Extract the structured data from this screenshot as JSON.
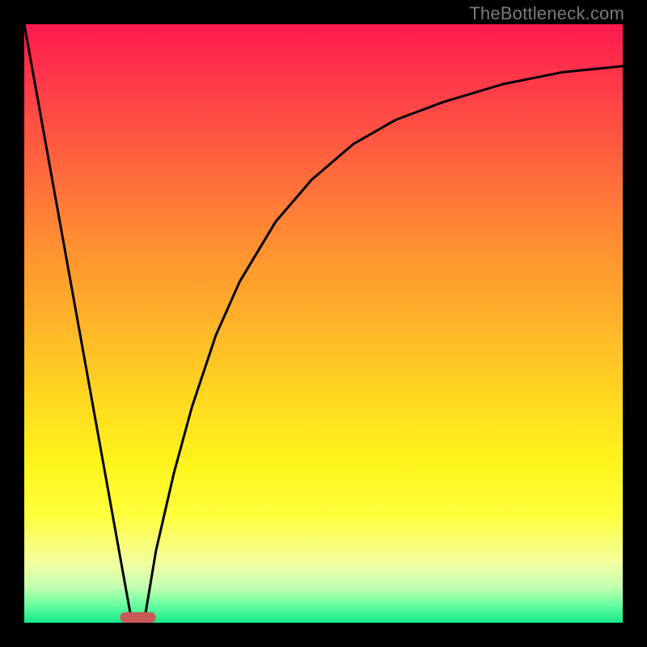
{
  "watermark": "TheBottleneck.com",
  "chart_data": {
    "type": "line",
    "title": "",
    "xlabel": "",
    "ylabel": "",
    "xlim": [
      0,
      100
    ],
    "ylim": [
      0,
      100
    ],
    "grid": false,
    "legend": false,
    "series": [
      {
        "name": "left-branch",
        "x": [
          0,
          18
        ],
        "y": [
          100,
          0
        ]
      },
      {
        "name": "right-branch",
        "x": [
          20,
          22,
          25,
          28,
          32,
          36,
          42,
          48,
          55,
          62,
          70,
          80,
          90,
          100
        ],
        "y": [
          0,
          12,
          25,
          36,
          48,
          57,
          67,
          74,
          80,
          84,
          87,
          90,
          92,
          93
        ]
      }
    ],
    "marker": {
      "name": "optimum-marker",
      "x_start": 16,
      "x_end": 22,
      "color": "#c95a5a"
    },
    "colors": {
      "curve": "#000000",
      "gradient_top": "#ff1a4f",
      "gradient_bottom": "#15e88a"
    }
  }
}
